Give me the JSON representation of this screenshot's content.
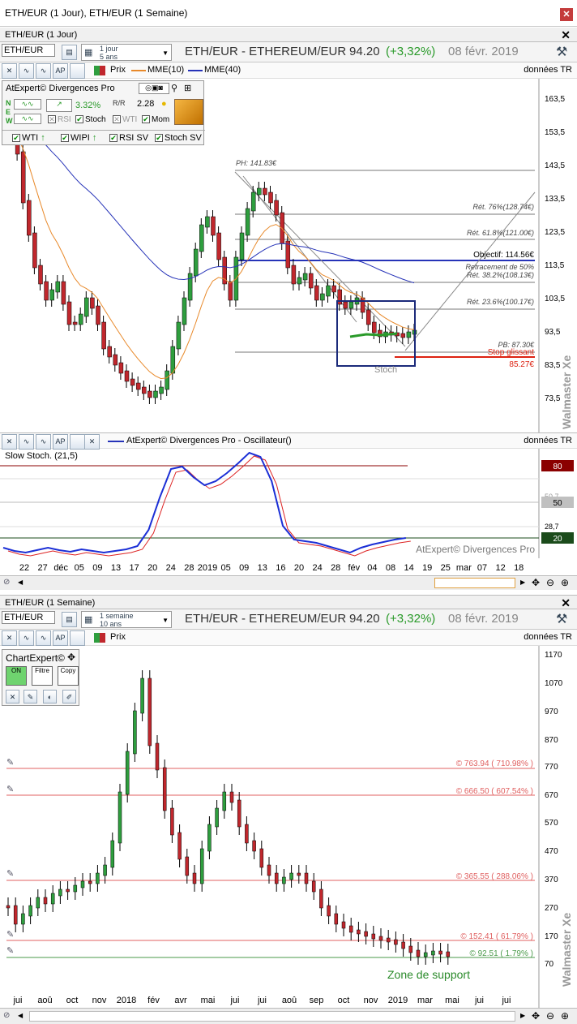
{
  "window": {
    "title": "ETH/EUR (1 Jour), ETH/EUR (1 Semaine)",
    "close": "✕"
  },
  "panel1": {
    "caption": "ETH/EUR (1 Jour)",
    "close": "✕",
    "symbol": "ETH/EUR",
    "period_top": "1 jour",
    "period_bottom": "5 ans",
    "heading": "ETH/EUR - ETHEREUM/EUR",
    "price": "94.20",
    "change": "(+3,32%)",
    "date": "08 févr. 2019",
    "legend_prix": "Prix",
    "legend_mme10": "MME(10)",
    "legend_mme40": "MME(40)",
    "donnees": "données TR",
    "watermark": "Walmaster Xe",
    "y_ticks": [
      "163,5",
      "153,5",
      "143,5",
      "133,5",
      "123,5",
      "113,5",
      "103,5",
      "93,5",
      "83,5",
      "73,5"
    ],
    "annotations": {
      "ph": "PH: 141.83€",
      "ret76": "Rét. 76%(128.74€)",
      "ret618": "Rét. 61.8%(121.00€)",
      "objectif": "Objectif: 114.56€",
      "ret50": "Retracement de 50%",
      "ret382": "Rét. 38.2%(108.13€)",
      "ret236": "Rét. 23.6%(100.17€)",
      "pb": "PB: 87.30€",
      "stop": "Stop glissant",
      "stopval": "85.27€",
      "stoch": "Stoch"
    },
    "colors": {
      "mme10": "#e8892a",
      "mme40": "#2633b8",
      "up": "#2e9e3e",
      "down": "#c0272d"
    }
  },
  "divergences": {
    "title": "AtExpert© Divergences Pro",
    "n": "N",
    "e": "E",
    "w": "W",
    "pct": "3.32%",
    "rr": "2.28",
    "rsi": "RSI",
    "stoch": "Stoch",
    "wti": "WTI",
    "mom": "Mom",
    "wti_sig": "WTI",
    "wipi_sig": "WIPI",
    "rsisv": "RSI SV",
    "stochsv": "Stoch SV"
  },
  "oscillator": {
    "title": "AtExpert© Divergences Pro - Oscillateur()",
    "donnees": "données TR",
    "name": "Slow Stoch. (21,5)",
    "levels": [
      "80",
      "50",
      "20"
    ],
    "faint_labels": [
      "50,7",
      "28,7"
    ],
    "brand": "AtExpert© Divergences Pro",
    "x_labels": [
      "22",
      "27",
      "déc",
      "05",
      "09",
      "13",
      "17",
      "20",
      "24",
      "28",
      "2019",
      "05",
      "09",
      "13",
      "16",
      "20",
      "24",
      "28",
      "fév",
      "04",
      "08",
      "14",
      "19",
      "25",
      "mar",
      "07",
      "12",
      "18"
    ]
  },
  "panel2": {
    "caption": "ETH/EUR (1 Semaine)",
    "close": "✕",
    "symbol": "ETH/EUR",
    "period_top": "1 semaine",
    "period_bottom": "10 ans",
    "heading": "ETH/EUR - ETHEREUM/EUR",
    "price": "94.20",
    "change": "(+3,32%)",
    "date": "08 févr. 2019",
    "legend_prix": "Prix",
    "donnees": "données TR",
    "watermark": "Walmaster Xe",
    "y_ticks": [
      "1170",
      "1070",
      "970",
      "870",
      "770",
      "670",
      "570",
      "470",
      "370",
      "270",
      "170",
      "70"
    ],
    "levels": [
      "© 763.94 ( 710.98% )",
      "© 666.50 ( 607.54% )",
      "© 365.55 ( 288.06% )",
      "© 152.41 ( 61.79% )",
      "© 92.51 ( 1.79% )"
    ],
    "support": "Zone de support",
    "x_labels": [
      "jui",
      "aoû",
      "oct",
      "nov",
      "2018",
      "fév",
      "avr",
      "mai",
      "jui",
      "jui",
      "aoû",
      "sep",
      "oct",
      "nov",
      "2019",
      "mar",
      "mai",
      "jui",
      "jui"
    ]
  },
  "chartexpert": {
    "title": "ChartExpert©",
    "on": "ON",
    "filtre": "Filtre",
    "copy": "Copy"
  }
}
